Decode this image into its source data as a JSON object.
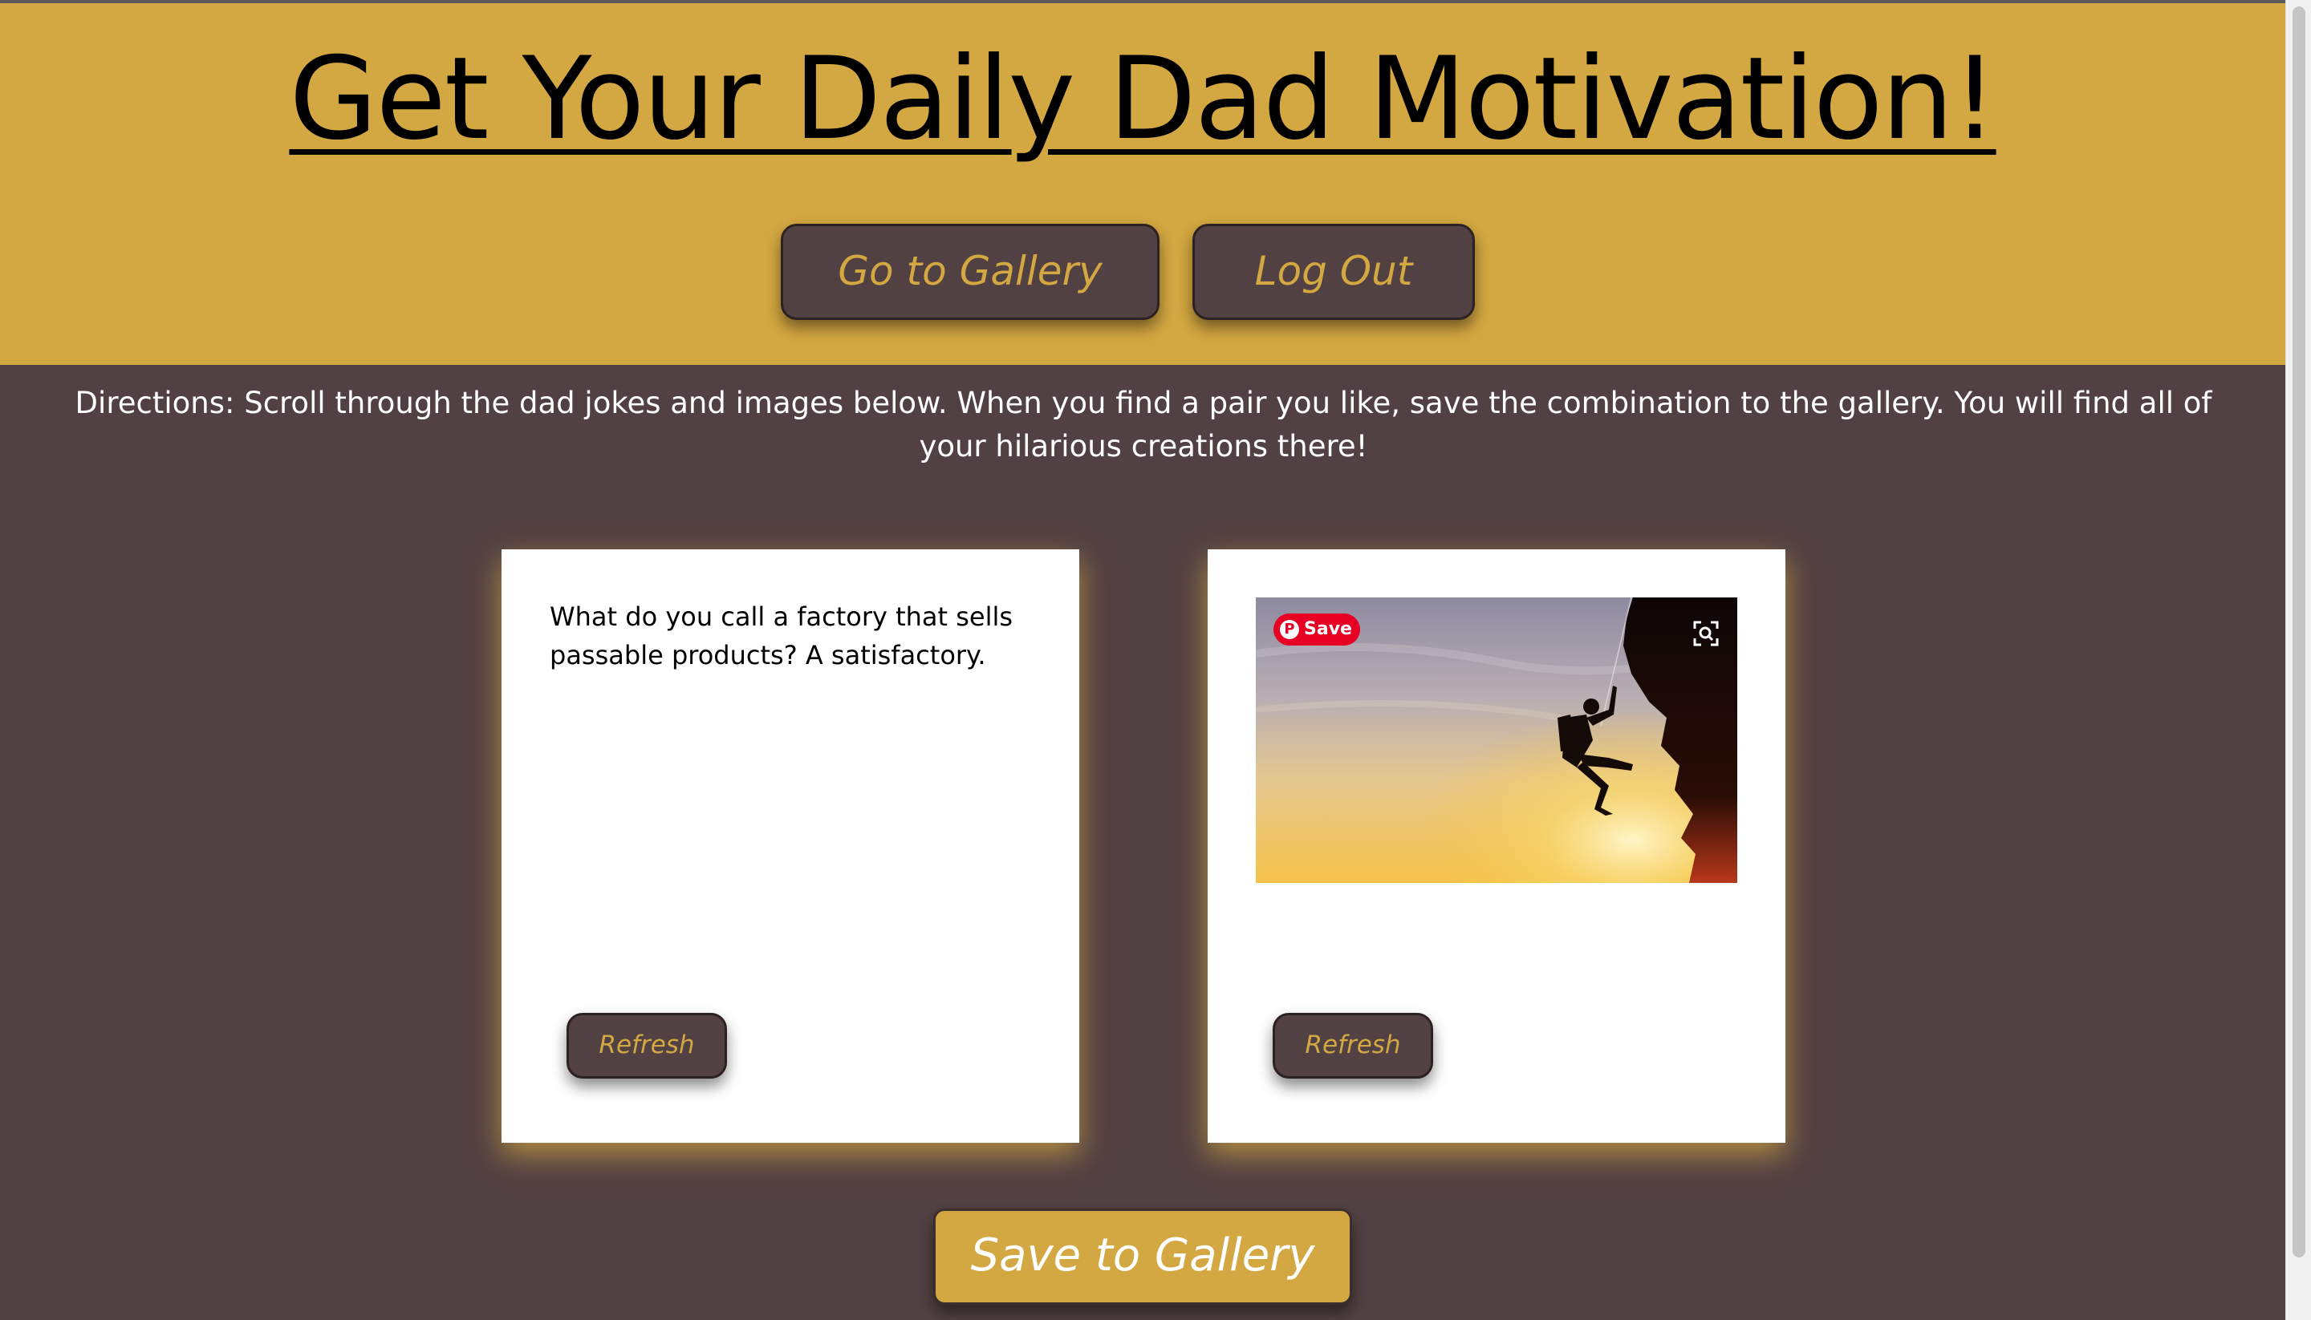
{
  "header": {
    "title": "Get Your Daily Dad Motivation!",
    "gallery_button": "Go to Gallery",
    "logout_button": "Log Out"
  },
  "directions": "Directions: Scroll through the dad jokes and images below. When you find a pair you like, save the combination to the gallery. You will find all of your hilarious creations there!",
  "joke_card": {
    "text": "What do you call a factory that sells passable products? A satisfactory.",
    "refresh_label": "Refresh"
  },
  "image_card": {
    "pin_save_label": "Save",
    "refresh_label": "Refresh"
  },
  "save_button": "Save to Gallery",
  "colors": {
    "gold": "#d3a741",
    "brown": "#524143",
    "white": "#ffffff",
    "pinterest_red": "#e60023"
  }
}
